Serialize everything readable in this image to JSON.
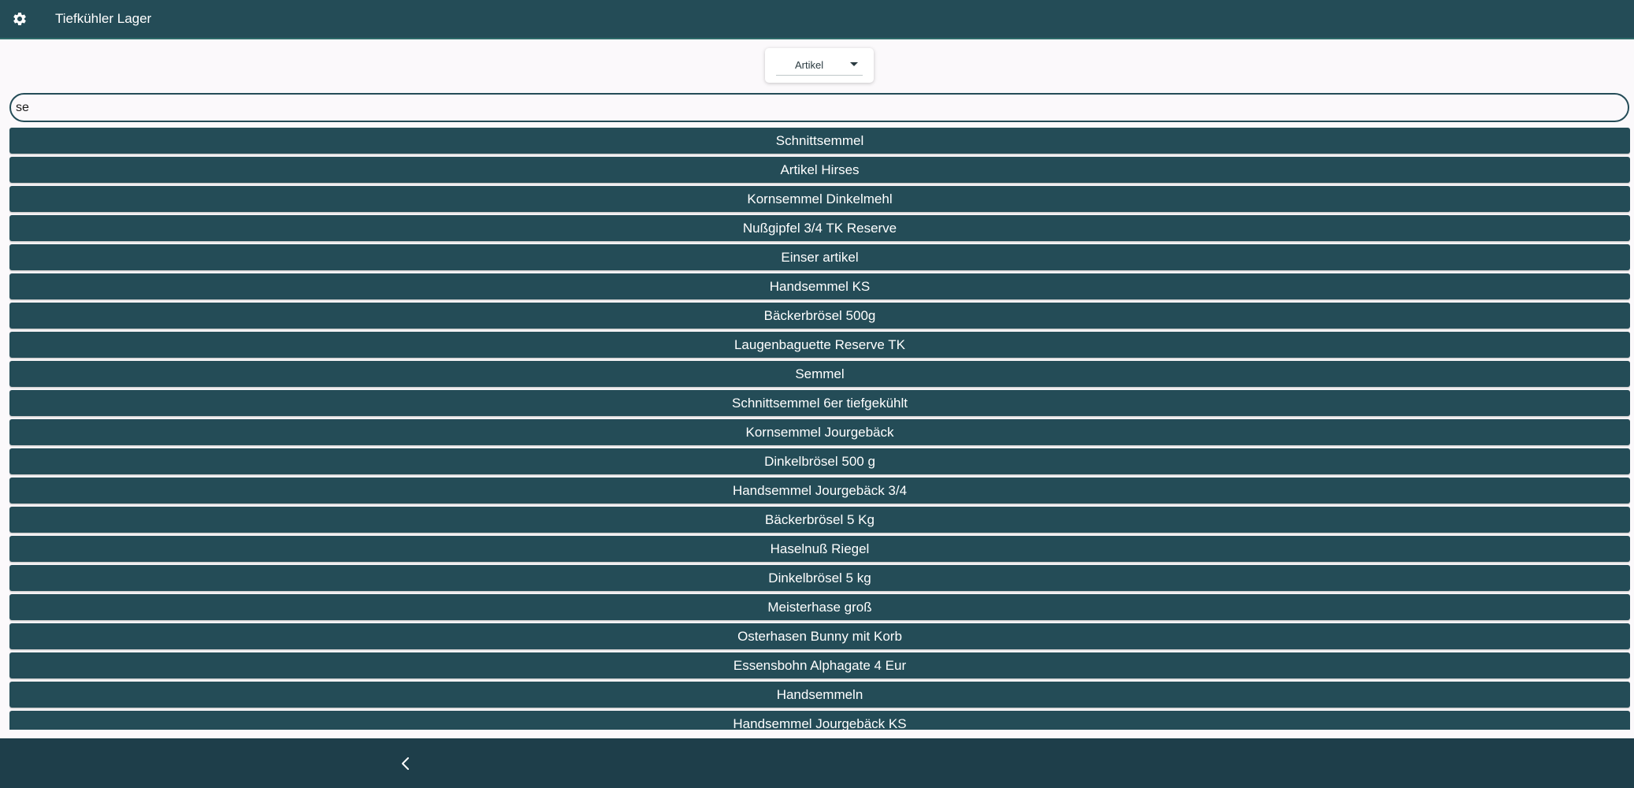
{
  "app_bar": {
    "title": "Tiefkühler Lager",
    "settings_icon": "gear-icon"
  },
  "selector": {
    "value": "Artikel",
    "caret_icon": "dropdown-caret-icon"
  },
  "search": {
    "value": "se"
  },
  "results": [
    "Schnittsemmel",
    "Artikel Hirses",
    "Kornsemmel Dinkelmehl",
    "Nußgipfel 3/4 TK Reserve",
    "Einser artikel",
    "Handsemmel KS",
    "Bäckerbrösel 500g",
    "Laugenbaguette Reserve TK",
    "Semmel",
    "Schnittsemmel 6er tiefgekühlt",
    "Kornsemmel Jourgebäck",
    "Dinkelbrösel 500 g",
    "Handsemmel Jourgebäck 3/4",
    "Bäckerbrösel 5 Kg",
    "Haselnuß Riegel",
    "Dinkelbrösel 5 kg",
    "Meisterhase groß",
    "Osterhasen Bunny mit Korb",
    "Essensbohn Alphagate 4 Eur",
    "Handsemmeln",
    "Handsemmel Jourgebäck KS"
  ],
  "bottom_bar": {
    "back_icon": "back-chevron-icon"
  },
  "colors": {
    "primary": "#244c57",
    "bottom_bar": "#1e3e4a",
    "background": "#fbf9fb",
    "text_on_primary": "#ffffff"
  }
}
